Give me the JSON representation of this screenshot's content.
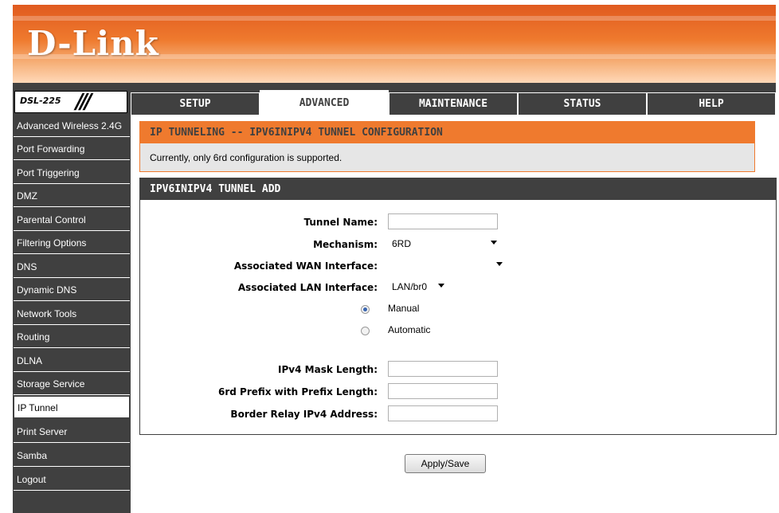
{
  "brand": {
    "logo": "D-Link",
    "model": "DSL-225",
    "slashes": "///"
  },
  "tabs": [
    {
      "label": "SETUP"
    },
    {
      "label": "ADVANCED"
    },
    {
      "label": "MAINTENANCE"
    },
    {
      "label": "STATUS"
    },
    {
      "label": "HELP"
    }
  ],
  "active_tab": "ADVANCED",
  "sidebar": {
    "items": [
      {
        "label": "Advanced Wireless 2.4G"
      },
      {
        "label": "Port Forwarding"
      },
      {
        "label": "Port Triggering"
      },
      {
        "label": "DMZ"
      },
      {
        "label": "Parental Control"
      },
      {
        "label": "Filtering Options"
      },
      {
        "label": "DNS"
      },
      {
        "label": "Dynamic DNS"
      },
      {
        "label": "Network Tools"
      },
      {
        "label": "Routing"
      },
      {
        "label": "DLNA"
      },
      {
        "label": "Storage Service"
      },
      {
        "label": "IP Tunnel"
      },
      {
        "label": "Print Server"
      },
      {
        "label": "Samba"
      },
      {
        "label": "Logout"
      }
    ],
    "active": "IP Tunnel"
  },
  "info": {
    "title": "IP TUNNELING -- IPV6INIPV4 TUNNEL CONFIGURATION",
    "text": "Currently, only 6rd configuration is supported."
  },
  "form": {
    "title": "IPV6INIPV4 TUNNEL ADD",
    "tunnel_name_label": "Tunnel Name:",
    "tunnel_name_value": "",
    "mechanism_label": "Mechanism:",
    "mechanism_value": "6RD",
    "wan_label": "Associated WAN Interface:",
    "wan_value": "",
    "lan_label": "Associated LAN Interface:",
    "lan_value": "LAN/br0",
    "manual_label": "Manual",
    "automatic_label": "Automatic",
    "mode_selected": "Manual",
    "mask_label": "IPv4 Mask Length:",
    "mask_value": "",
    "prefix_label": "6rd Prefix with Prefix Length:",
    "prefix_value": "",
    "relay_label": "Border Relay IPv4 Address:",
    "relay_value": ""
  },
  "apply_label": "Apply/Save",
  "colors": {
    "orange": "#ef7a2e",
    "dark": "#404040",
    "banner": "#e05a1f"
  }
}
